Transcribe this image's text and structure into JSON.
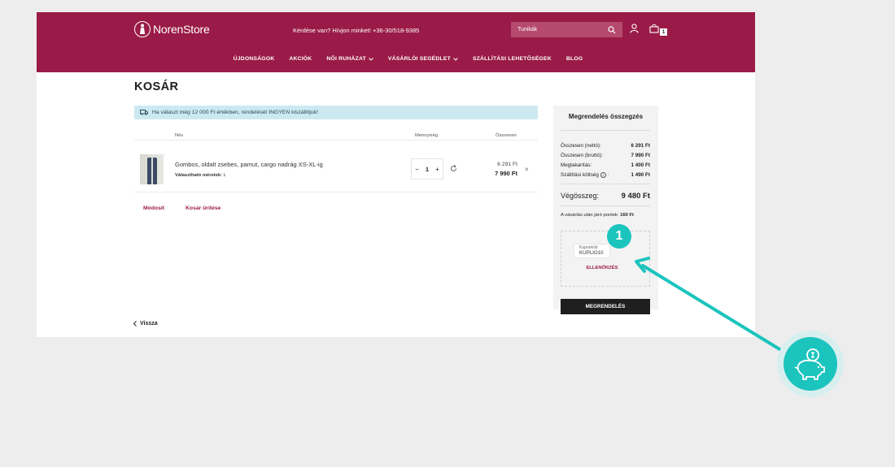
{
  "brand": {
    "name": "NorenStore",
    "color": "#9a1b47",
    "accent": "#1cc4be"
  },
  "header": {
    "contact_text": "Kérdése van? Hívjon minket! +36-30/518-9385",
    "search_value": "Tunikák",
    "cart_count": "1"
  },
  "nav": [
    "ÚJDONSÁGOK",
    "AKCIÓK",
    "NŐI RUHÁZAT",
    "VÁSÁRLÓI SEGÉDLET",
    "SZÁLLÍTÁSI LEHETŐSÉGEK",
    "BLOG"
  ],
  "page": {
    "title": "KOSÁR",
    "banner": "Ha választ még 12 000 Ft értékben, rendelését INGYEN kiszállítjuk!",
    "col_name": "Név",
    "col_qty": "Mennyiség",
    "col_total": "Összesen"
  },
  "item": {
    "name": "Gombos, oldalt zsebes, pamut, cargo nadrág XS-XL-ig",
    "size_label": "Választható méretek:",
    "size_value": "L",
    "qty": "1",
    "price_net": "6 291 Ft",
    "price_gross": "7 990 Ft"
  },
  "actions": {
    "modify": "Módosít",
    "empty": "Kosár ürítése",
    "back": "Vissza"
  },
  "summary": {
    "title": "Megrendelés összegzés",
    "rows": [
      {
        "label": "Összesen (nettó):",
        "value": "6 291 Ft"
      },
      {
        "label": "Összesen (bruttó):",
        "value": "7 990 Ft"
      },
      {
        "label": "Megtakarítás:",
        "value": "1 400 Ft"
      },
      {
        "label": "Szállítási költség",
        "value": "1 490 Ft"
      }
    ],
    "total_label": "Végösszeg:",
    "total_value": "9 480 Ft",
    "points_label": "A vásárlás után járó pontok:",
    "points_value": "160 Ft",
    "coupon_label": "Kuponkód",
    "coupon_value": "KUPLIO10",
    "check_label": "ELLENŐRZÉS",
    "submit_label": "MEGRENDELÉS"
  },
  "annotation": {
    "step": "1"
  }
}
